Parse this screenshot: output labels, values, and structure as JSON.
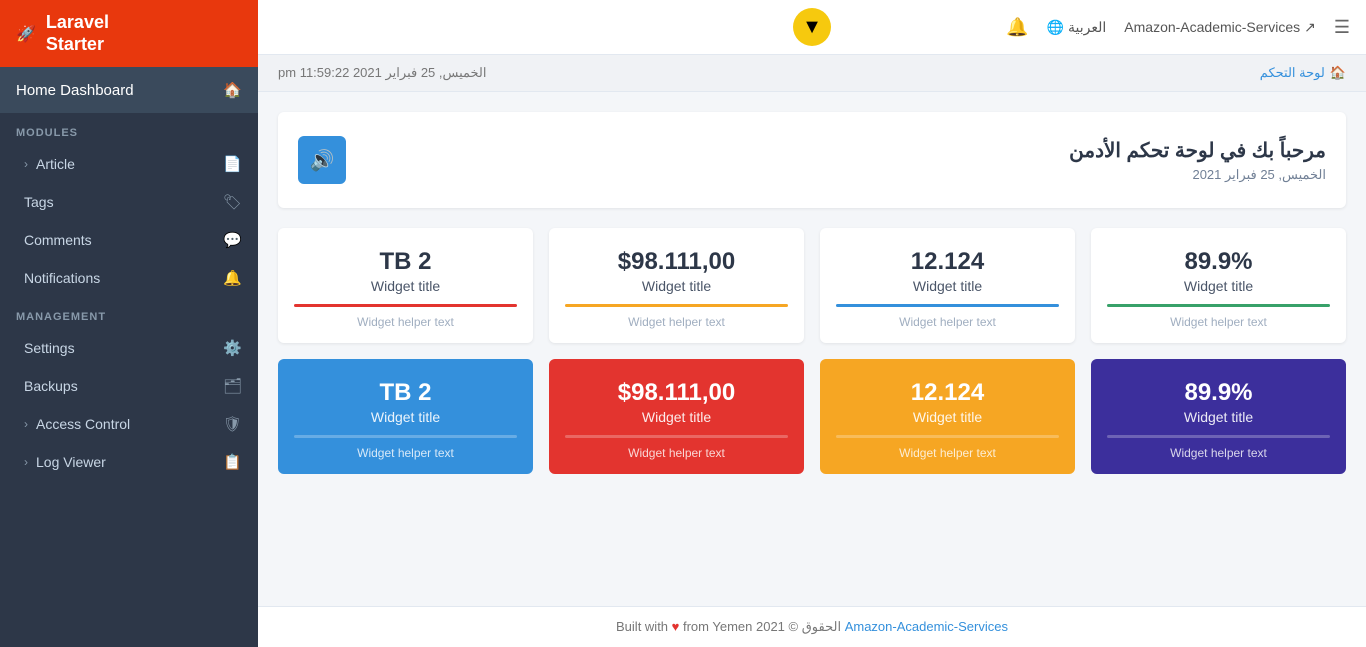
{
  "sidebar": {
    "brand": {
      "line1": "Laravel",
      "line2": "Starter"
    },
    "home_dashboard": "Home Dashboard",
    "sections": [
      {
        "label": "MODULES",
        "items": [
          {
            "name": "Article",
            "icon": "📄",
            "has_arrow": true
          },
          {
            "name": "Tags",
            "icon": "🏷",
            "has_arrow": false
          },
          {
            "name": "Comments",
            "icon": "💬",
            "has_arrow": false
          },
          {
            "name": "Notifications",
            "icon": "🔔",
            "has_arrow": false
          }
        ]
      },
      {
        "label": "MANAGEMENT",
        "items": [
          {
            "name": "Settings",
            "icon": "⚙️",
            "has_arrow": false
          },
          {
            "name": "Backups",
            "icon": "🗂",
            "has_arrow": false
          },
          {
            "name": "Access Control",
            "icon": "🛡",
            "has_arrow": true
          },
          {
            "name": "Log Viewer",
            "icon": "📋",
            "has_arrow": true
          }
        ]
      }
    ]
  },
  "topnav": {
    "logo_icon": "▼",
    "bell_icon": "🔔",
    "language": "العربية",
    "service_name": "Amazon-Academic-Services",
    "hamburger": "☰"
  },
  "breadcrumb": {
    "link_text": "لوحة التحكم",
    "datetime": "الخميس, 25 فبراير 2021 11:59:22 pm"
  },
  "welcome": {
    "title": "مرحباً بك في لوحة تحكم الأدمن",
    "date": "الخميس, 25 فبراير 2021",
    "speaker_icon": "🔊"
  },
  "widgets_white": [
    {
      "value": "TB 2",
      "title": "Widget title",
      "divider_color": "#e3342f",
      "helper": "Widget helper text"
    },
    {
      "value": "$98.111,00",
      "title": "Widget title",
      "divider_color": "#f6a623",
      "helper": "Widget helper text"
    },
    {
      "value": "12.124",
      "title": "Widget title",
      "divider_color": "#3490dc",
      "helper": "Widget helper text"
    },
    {
      "value": "89.9%",
      "title": "Widget title",
      "divider_color": "#38a169",
      "helper": "Widget helper text"
    }
  ],
  "widgets_colored": [
    {
      "value": "TB 2",
      "title": "Widget title",
      "helper": "Widget helper text",
      "bg": "bg-blue",
      "divider_color": "rgba(255,255,255,0.5)"
    },
    {
      "value": "$98.111,00",
      "title": "Widget title",
      "helper": "Widget helper text",
      "bg": "bg-red",
      "divider_color": "rgba(255,255,255,0.5)"
    },
    {
      "value": "12.124",
      "title": "Widget title",
      "helper": "Widget helper text",
      "bg": "bg-yellow",
      "divider_color": "rgba(255,255,255,0.5)"
    },
    {
      "value": "89.9%",
      "title": "Widget title",
      "helper": "Widget helper text",
      "bg": "bg-purple",
      "divider_color": "rgba(255,255,255,0.5)"
    }
  ],
  "footer": {
    "text": "Built with ♥ from Yemen",
    "year": "2021 ©",
    "rights": "الحقوق",
    "link_text": "Amazon-Academic-Services"
  }
}
